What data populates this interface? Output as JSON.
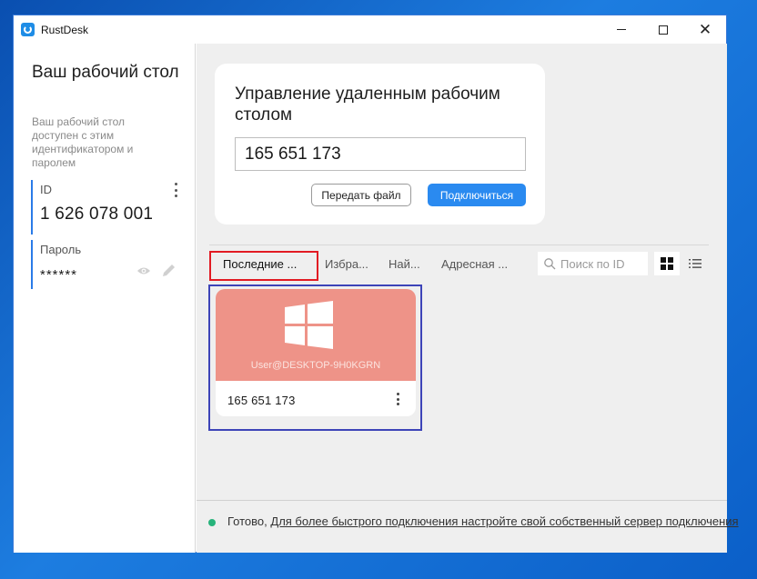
{
  "window": {
    "title": "RustDesk",
    "controls": {
      "minimize": "minimize",
      "maximize": "maximize",
      "close": "✕"
    }
  },
  "sidebar": {
    "title": "Ваш рабочий стол",
    "description": "Ваш рабочий стол доступен с этим идентификатором и паролем",
    "id_label": "ID",
    "id_value": "1 626 078 001",
    "password_label": "Пароль",
    "password_value": "******"
  },
  "connect": {
    "title": "Управление удаленным рабочим столом",
    "id_input_value": "165 651 173",
    "transfer_file_label": "Передать файл",
    "connect_label": "Подключиться",
    "accent_color": "#2a8af0"
  },
  "tabs": [
    {
      "label": "Последние ...",
      "active": true
    },
    {
      "label": "Избра...",
      "active": false
    },
    {
      "label": "Най...",
      "active": false
    },
    {
      "label": "Адресная ...",
      "active": false
    }
  ],
  "search": {
    "placeholder": "Поиск по ID"
  },
  "view": {
    "mode": "grid"
  },
  "peers": [
    {
      "user": "User@DESKTOP-9H0KGRN",
      "id": "165 651 173",
      "platform_icon": "windows-icon",
      "thumb_color": "#ee9388"
    }
  ],
  "status": {
    "text": "Готово,",
    "link": "Для более быстрого подключения настройте свой собственный сервер подключения",
    "indicator_color": "#27b37b"
  }
}
